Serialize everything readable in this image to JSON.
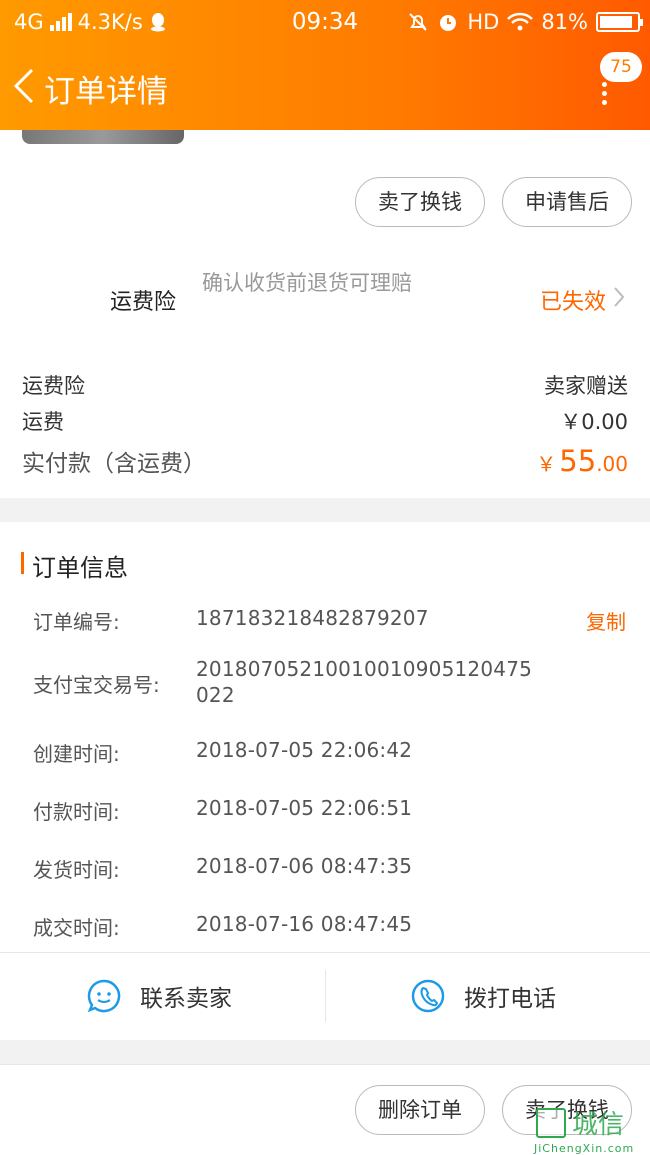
{
  "status_bar": {
    "network": "4G",
    "speed": "4.3K/s",
    "time": "09:34",
    "hd": "HD",
    "battery": "81%"
  },
  "header": {
    "title": "订单详情",
    "badge": "75"
  },
  "actions_top": {
    "sell_button": "卖了换钱",
    "aftersale_button": "申请售后"
  },
  "insurance": {
    "label": "运费险",
    "description": "确认收货前退货可理赔",
    "status": "已失效"
  },
  "fees": {
    "insurance_label": "运费险",
    "insurance_value": "卖家赠送",
    "shipping_label": "运费",
    "shipping_value": "￥0.00",
    "paid_label": "实付款（含运费）",
    "paid_currency": "￥",
    "paid_integer": "55",
    "paid_decimal": ".00"
  },
  "order_info": {
    "title": "订单信息",
    "copy": "复制",
    "items": [
      {
        "key": "订单编号:",
        "value": "187183218482879207"
      },
      {
        "key": "支付宝交易号:",
        "value": "20180705210010010905120475022"
      },
      {
        "key": "创建时间:",
        "value": "2018-07-05 22:06:42"
      },
      {
        "key": "付款时间:",
        "value": "2018-07-05 22:06:51"
      },
      {
        "key": "发货时间:",
        "value": "2018-07-06 08:47:35"
      },
      {
        "key": "成交时间:",
        "value": "2018-07-16 08:47:45"
      }
    ],
    "contact_seller": "联系卖家",
    "call_phone": "拨打电话"
  },
  "bottom_bar": {
    "delete_button": "删除订单",
    "sell_button": "卖了换钱"
  },
  "watermark": {
    "text": "城信",
    "sub": "JiChengXin.com"
  },
  "colors": {
    "accent": "#ff6600",
    "header_start": "#ff9a00",
    "header_end": "#ff5a00",
    "icon_blue": "#1e9be6"
  }
}
